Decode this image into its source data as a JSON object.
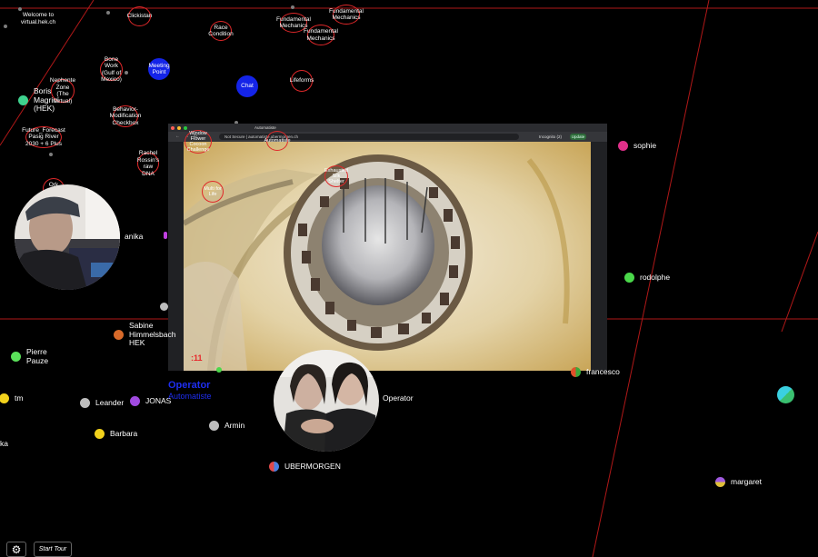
{
  "space_links": [
    {
      "label": "Welcome to virtual.hek.ch"
    },
    {
      "label": "Clickistan"
    },
    {
      "label": "Race Condition"
    },
    {
      "label": "Fundamental Mechanics"
    },
    {
      "label": "Fundamental Mechanics"
    },
    {
      "label": "Fundamental Mechanics"
    },
    {
      "label": "Bone Work (Gulf of Mexico)"
    },
    {
      "label": "Lifeforms"
    },
    {
      "label": "Nephente Zone (The Virtual)"
    },
    {
      "label": "Behavior-Modification Checkbox"
    },
    {
      "label": "Future_Forecast Pasig River 2030 + 6 Plus"
    },
    {
      "label": "Rachel Rossin's raw DNA"
    },
    {
      "label": "Ork Haus"
    },
    {
      "label": "Window Flower Cocoon Challenge"
    },
    {
      "label": "Automatiste"
    },
    {
      "label": "Multi for Life"
    },
    {
      "label": "Exhausted Silk Shelter"
    }
  ],
  "rooms": [
    {
      "label": "Meeting Point"
    },
    {
      "label": "Chat"
    }
  ],
  "users": [
    {
      "name": "Boris Magrini (HEK)",
      "color": "#3fd28e"
    },
    {
      "name": "anika",
      "color": "#c040e0"
    },
    {
      "name": "sophie",
      "color": "#e0308a"
    },
    {
      "name": "rodolphe",
      "color": "#4ad84a"
    },
    {
      "name": "Sabine Himmelsbach HEK",
      "color": "#d86a2a"
    },
    {
      "name": "Pierre Pauze",
      "color": "#5ae05a"
    },
    {
      "name": "tm",
      "color": "#f2d21c"
    },
    {
      "name": "Leander",
      "color": "#bdbdbd"
    },
    {
      "name": "JONAS",
      "color": "#a04ae0"
    },
    {
      "name": "Barbara",
      "color": "#f2d21c"
    },
    {
      "name": "Armin",
      "color": "#bdbdbd"
    },
    {
      "name": "UBERMORGEN",
      "color": "#e04a4a"
    },
    {
      "name": "francesco",
      "color": "#e0502a"
    },
    {
      "name": "Operator",
      "color": "#ffffff"
    },
    {
      "name": "margaret",
      "color": "#a05ae0"
    },
    {
      "name": "ka",
      "color": "#ffffff"
    }
  ],
  "operator": {
    "title": "Operator",
    "subtitle": "Automatiste"
  },
  "screen_share": {
    "tab_title": "Automatiste",
    "url": "Not Secure | automatiste.ubermorgen.ch",
    "incognito_label": "Incognito (2)",
    "update_label": "Update",
    "timecode": ":11"
  },
  "controls": {
    "settings_icon": "gear-icon",
    "start_tour_label": "Start Tour"
  },
  "colors": {
    "background": "#000000",
    "link_ring": "#e0282a",
    "room": "#1424e8",
    "operator": "#1e2ef0"
  }
}
